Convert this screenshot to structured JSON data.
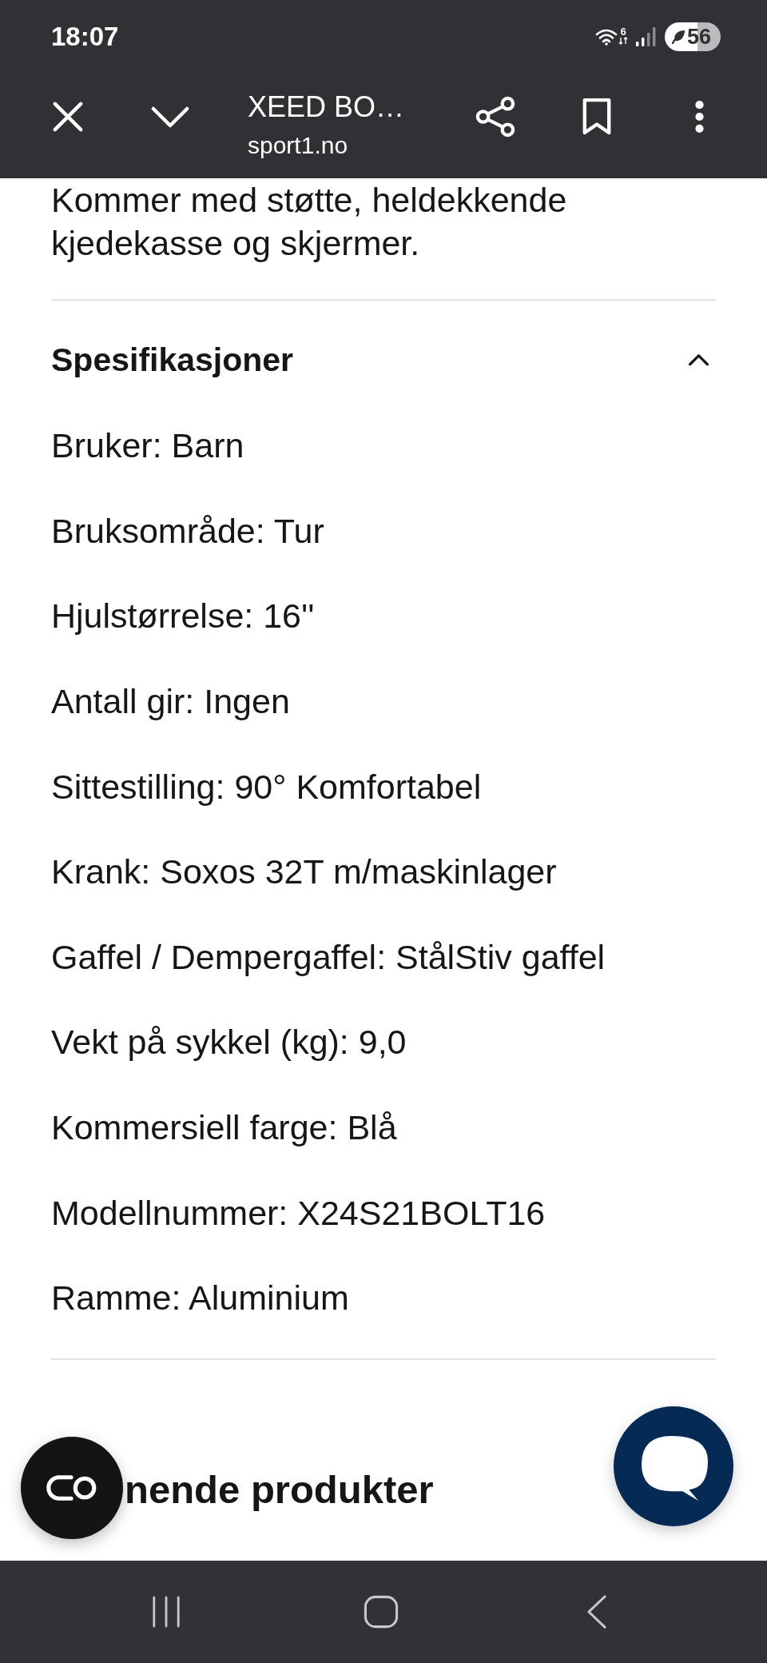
{
  "status_bar": {
    "time": "18:07",
    "wifi_badge": "6",
    "battery": "56"
  },
  "toolbar": {
    "title": "XEED BO…",
    "url": "sport1.no"
  },
  "description": "Kommer med støtte, heldekkende kjedekasse og skjermer.",
  "specifications": {
    "title": "Spesifikasjoner",
    "expanded": true,
    "items": [
      "Bruker: Barn",
      "Bruksområde: Tur",
      "Hjulstørrelse: 16''",
      "Antall gir: Ingen",
      "Sittestilling: 90° Komfortabel",
      "Krank: Soxos 32T m/maskinlager",
      "Gaffel / Dempergaffel: StålStiv gaffel",
      "Vekt på sykkel (kg): 9,0",
      "Kommersiell farge: Blå",
      "Modellnummer: X24S21BOLT16",
      "Ramme: Aluminium"
    ]
  },
  "related": {
    "title": "nende produkter"
  }
}
